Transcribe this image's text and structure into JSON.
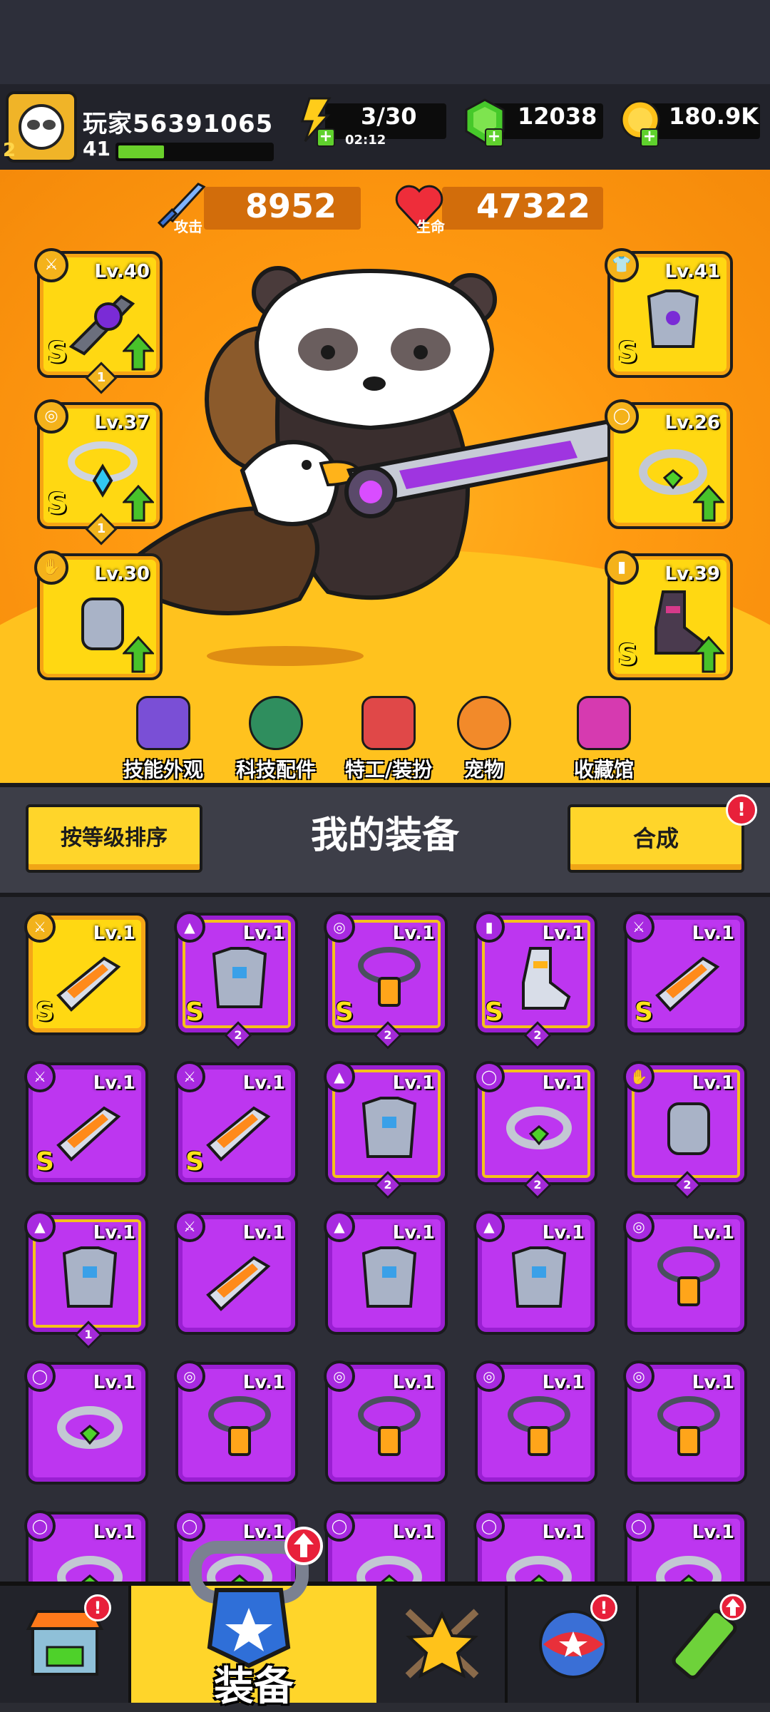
{
  "player": {
    "name": "玩家56391065",
    "level": "41",
    "vip": "2",
    "xp_fraction": 0.3
  },
  "resources": {
    "energy": "3/30",
    "energy_timer": "02:12",
    "gems": "12038",
    "gold": "180.9K"
  },
  "stats": {
    "attack_value": "8952",
    "attack_label": "攻击",
    "hp_value": "47322",
    "hp_label": "生命"
  },
  "equipped": {
    "left": [
      {
        "level": "Lv.40",
        "rank": "S",
        "stars": "1",
        "icon": "weapon-icon",
        "upgrade": true
      },
      {
        "level": "Lv.37",
        "rank": "S",
        "stars": "1",
        "icon": "necklace-icon",
        "upgrade": true
      },
      {
        "level": "Lv.30",
        "rank": "",
        "stars": "",
        "icon": "gloves-icon",
        "upgrade": true
      }
    ],
    "right": [
      {
        "level": "Lv.41",
        "rank": "S",
        "stars": "",
        "icon": "armor-icon",
        "upgrade": false
      },
      {
        "level": "Lv.26",
        "rank": "",
        "stars": "",
        "icon": "ring-icon",
        "upgrade": true
      },
      {
        "level": "Lv.39",
        "rank": "S",
        "stars": "",
        "icon": "boots-icon",
        "upgrade": true
      }
    ]
  },
  "nav": {
    "skill_skins": "技能外观",
    "tech_parts": "科技配件",
    "agents_outfit": "特工/装扮",
    "pets": "宠物",
    "collection": "收藏馆"
  },
  "equipment_panel": {
    "sort_label": "按等级排序",
    "title": "我的装备",
    "merge_label": "合成",
    "merge_alert": "!"
  },
  "inventory": [
    {
      "level": "Lv.1",
      "rank": "S",
      "stars": "",
      "color": "gold",
      "icon": "weapon-icon"
    },
    {
      "level": "Lv.1",
      "rank": "S",
      "stars": "2",
      "color": "purple",
      "icon": "armor-icon"
    },
    {
      "level": "Lv.1",
      "rank": "S",
      "stars": "2",
      "color": "purple",
      "icon": "necklace-icon"
    },
    {
      "level": "Lv.1",
      "rank": "S",
      "stars": "2",
      "color": "purple",
      "icon": "boots-icon"
    },
    {
      "level": "Lv.1",
      "rank": "S",
      "stars": "",
      "color": "purple",
      "icon": "weapon-icon"
    },
    {
      "level": "Lv.1",
      "rank": "S",
      "stars": "",
      "color": "purple",
      "icon": "weapon-icon"
    },
    {
      "level": "Lv.1",
      "rank": "S",
      "stars": "",
      "color": "purple",
      "icon": "weapon-icon"
    },
    {
      "level": "Lv.1",
      "rank": "",
      "stars": "2",
      "color": "purple",
      "icon": "armor-icon"
    },
    {
      "level": "Lv.1",
      "rank": "",
      "stars": "2",
      "color": "purple",
      "icon": "ring-icon"
    },
    {
      "level": "Lv.1",
      "rank": "",
      "stars": "2",
      "color": "purple",
      "icon": "gloves-icon"
    },
    {
      "level": "Lv.1",
      "rank": "",
      "stars": "1",
      "color": "purple",
      "icon": "armor-icon"
    },
    {
      "level": "Lv.1",
      "rank": "",
      "stars": "",
      "color": "purple",
      "icon": "weapon-icon"
    },
    {
      "level": "Lv.1",
      "rank": "",
      "stars": "",
      "color": "purple",
      "icon": "armor-icon"
    },
    {
      "level": "Lv.1",
      "rank": "",
      "stars": "",
      "color": "purple",
      "icon": "armor-icon"
    },
    {
      "level": "Lv.1",
      "rank": "",
      "stars": "",
      "color": "purple",
      "icon": "necklace-icon"
    },
    {
      "level": "Lv.1",
      "rank": "",
      "stars": "",
      "color": "purple",
      "icon": "ring-icon"
    },
    {
      "level": "Lv.1",
      "rank": "",
      "stars": "",
      "color": "purple",
      "icon": "necklace-icon"
    },
    {
      "level": "Lv.1",
      "rank": "",
      "stars": "",
      "color": "purple",
      "icon": "necklace-icon"
    },
    {
      "level": "Lv.1",
      "rank": "",
      "stars": "",
      "color": "purple",
      "icon": "necklace-icon"
    },
    {
      "level": "Lv.1",
      "rank": "",
      "stars": "",
      "color": "purple",
      "icon": "necklace-icon"
    },
    {
      "level": "Lv.1",
      "rank": "",
      "stars": "",
      "color": "purple",
      "icon": "ring-icon"
    },
    {
      "level": "Lv.1",
      "rank": "",
      "stars": "",
      "color": "purple",
      "icon": "ring-icon"
    },
    {
      "level": "Lv.1",
      "rank": "",
      "stars": "",
      "color": "purple",
      "icon": "ring-icon"
    },
    {
      "level": "Lv.1",
      "rank": "",
      "stars": "",
      "color": "purple",
      "icon": "ring-icon"
    },
    {
      "level": "Lv.1",
      "rank": "",
      "stars": "",
      "color": "purple",
      "icon": "ring-icon"
    }
  ],
  "tabs": {
    "shop_alert": "!",
    "equip_label": "装备",
    "events_alert": "!"
  },
  "colors": {
    "gold_slot": "#ffd812",
    "purple_slot": "#bd36f0",
    "hero_bg": "#ff9a11",
    "alert_red": "#e8203a",
    "upgrade_green": "#48c22a"
  }
}
